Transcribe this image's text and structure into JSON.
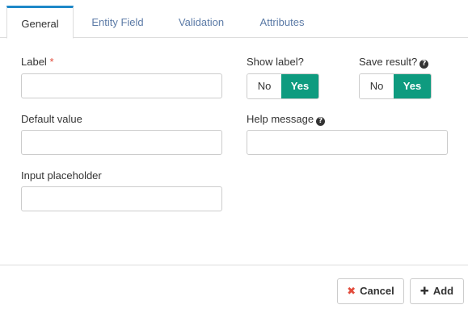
{
  "tabs": [
    {
      "label": "General"
    },
    {
      "label": "Entity Field"
    },
    {
      "label": "Validation"
    },
    {
      "label": "Attributes"
    }
  ],
  "form": {
    "label_field": {
      "label": "Label",
      "required_mark": "*",
      "value": "",
      "placeholder": ""
    },
    "show_label": {
      "label": "Show label?",
      "no": "No",
      "yes": "Yes",
      "selected": "Yes"
    },
    "save_result": {
      "label": "Save result?",
      "no": "No",
      "yes": "Yes",
      "selected": "Yes"
    },
    "default_value": {
      "label": "Default value",
      "value": "",
      "placeholder": ""
    },
    "help_message": {
      "label": "Help message",
      "value": "",
      "placeholder": ""
    },
    "input_placeholder": {
      "label": "Input placeholder",
      "value": "",
      "placeholder": ""
    }
  },
  "footer": {
    "cancel_label": "Cancel",
    "add_label": "Add"
  },
  "colors": {
    "accent": "#0e9b7f",
    "active_tab_border": "#1e88c8",
    "required": "#e24c3c"
  },
  "icons": {
    "help": "question-circle-icon",
    "cancel": "times-icon",
    "add": "plus-icon"
  }
}
